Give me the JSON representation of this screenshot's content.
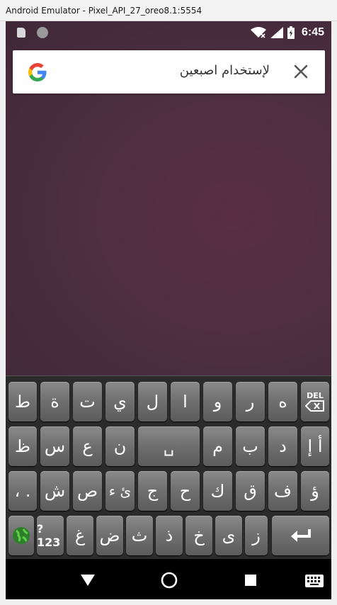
{
  "window": {
    "title": "Android Emulator - Pixel_API_27_oreo8.1:5554"
  },
  "status_bar": {
    "time": "6:45",
    "icons": [
      "sd-card-icon",
      "notification-dot-icon",
      "wifi-icon",
      "cell-signal-icon",
      "battery-icon"
    ]
  },
  "search": {
    "text": "لإستخدام اصبعين",
    "logo": "google-g-icon",
    "clear_icon": "close-icon"
  },
  "keyboard": {
    "row1": [
      "ط",
      "ة",
      "ت",
      "ي",
      "ل",
      "ا",
      "و",
      "ر",
      "ه",
      "DEL"
    ],
    "row2": [
      "أ إ",
      "د",
      "ب",
      "م",
      "␣",
      "ن",
      "ع",
      "س",
      "ظ"
    ],
    "row3": [
      "ؤ",
      "ف",
      "ق",
      "ك",
      "ح",
      "ج",
      "ئ ء",
      "ص",
      "ش",
      "، ."
    ],
    "row4": [
      "globe",
      "?123",
      "غ",
      "ض",
      "ث",
      "ذ",
      "خ",
      "ى",
      "ز",
      "enter"
    ]
  },
  "nav": {
    "back": "back-triangle-icon",
    "home": "home-circle-icon",
    "recents": "recents-square-icon",
    "keyboard": "keyboard-icon"
  }
}
